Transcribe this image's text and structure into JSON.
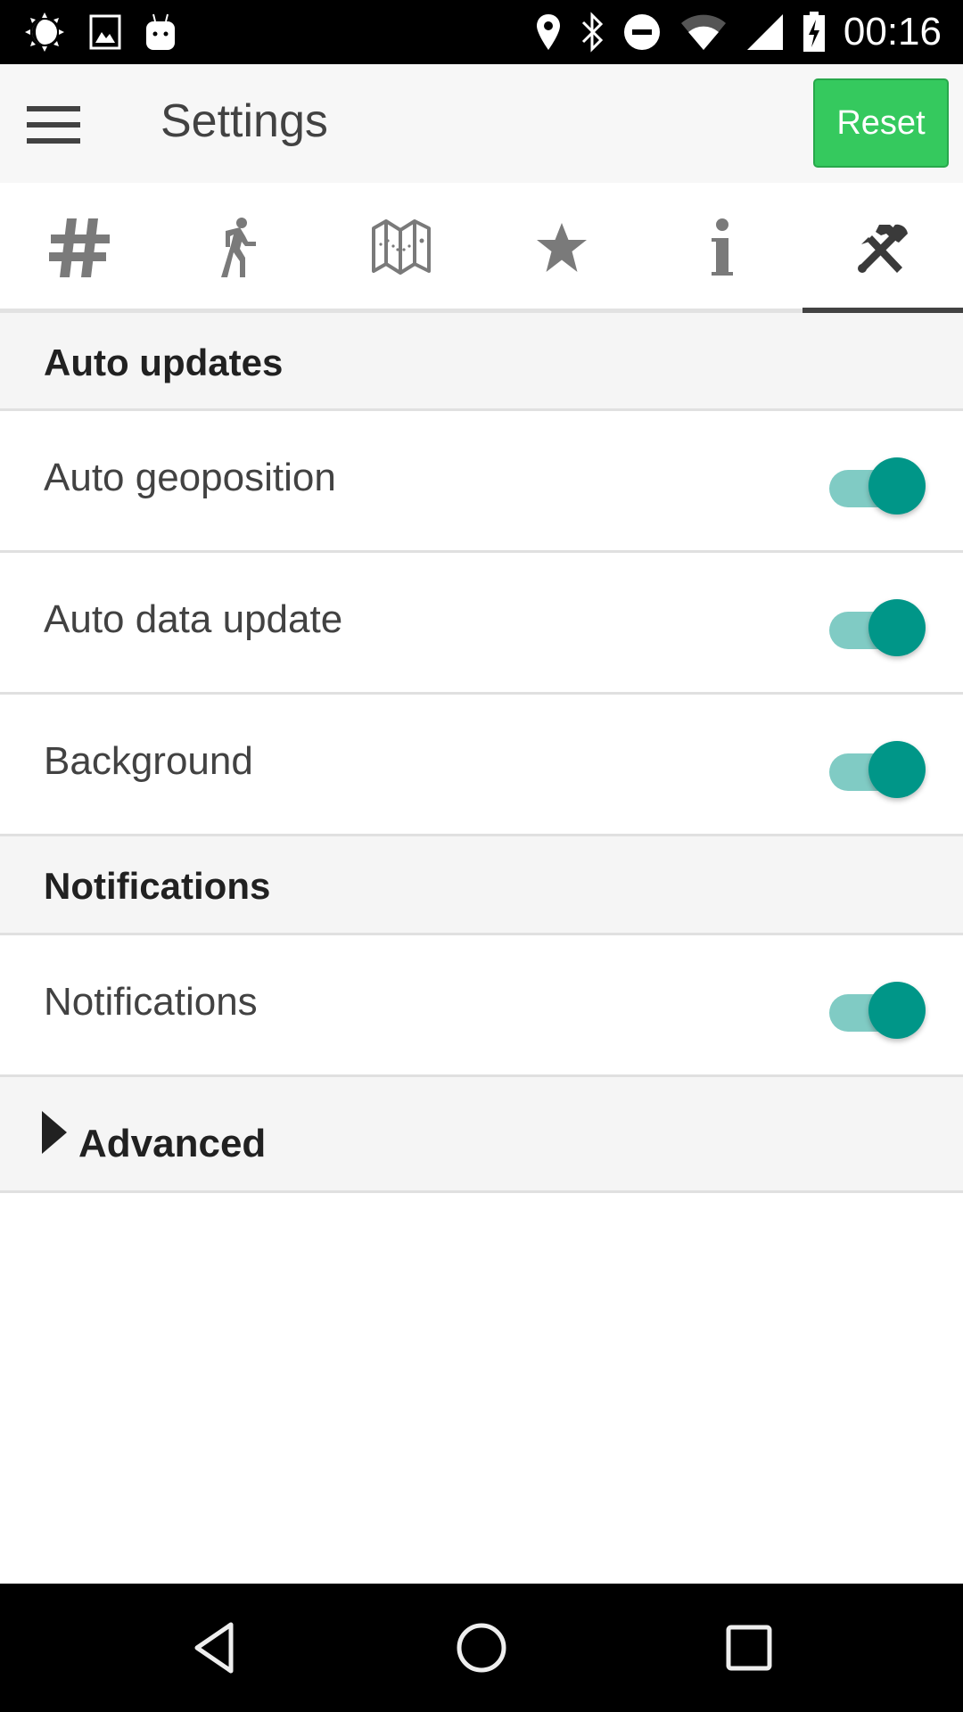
{
  "status_bar": {
    "left_icons": [
      "brightness-icon",
      "image-icon",
      "android-icon"
    ],
    "right_icons": [
      "location-icon",
      "bluetooth-icon",
      "do-not-disturb-icon",
      "wifi-icon",
      "signal-icon",
      "battery-charging-icon"
    ],
    "time": "00:16"
  },
  "toolbar": {
    "menu_icon": "hamburger-menu-icon",
    "title": "Settings",
    "reset_label": "Reset",
    "reset_color": "#35c95e"
  },
  "tabs": [
    {
      "icon": "hash-icon",
      "selected": false
    },
    {
      "icon": "walking-person-icon",
      "selected": false
    },
    {
      "icon": "map-icon",
      "selected": false
    },
    {
      "icon": "star-icon",
      "selected": false
    },
    {
      "icon": "info-icon",
      "selected": false
    },
    {
      "icon": "tools-icon",
      "selected": true
    }
  ],
  "sections": {
    "auto_updates": {
      "title": "Auto updates",
      "items": [
        {
          "label": "Auto geoposition",
          "enabled": true
        },
        {
          "label": "Auto data update",
          "enabled": true
        },
        {
          "label": "Background",
          "enabled": true
        }
      ]
    },
    "notifications": {
      "title": "Notifications",
      "items": [
        {
          "label": "Notifications",
          "enabled": true
        }
      ]
    },
    "advanced": {
      "title": "Advanced",
      "expanded": false
    }
  },
  "colors": {
    "switch_thumb": "#009688",
    "switch_track": "#80cbc4",
    "tab_icon": "#7a7a7a",
    "tab_selected": "#424242"
  },
  "nav_bar": {
    "back": "back-icon",
    "home": "home-icon",
    "recents": "recents-icon"
  }
}
